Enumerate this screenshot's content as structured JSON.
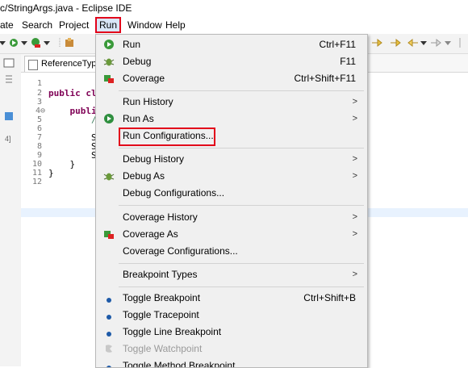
{
  "window": {
    "title": "c/StringArgs.java - Eclipse IDE"
  },
  "menubar": {
    "items": [
      "ate",
      "Search",
      "Project",
      "Run",
      "Window",
      "Help"
    ]
  },
  "editor": {
    "tab_label": "ReferenceType",
    "line_numbers": [
      "1",
      "2",
      "3",
      "4⊖",
      "5",
      "6",
      "7",
      "8",
      "9",
      "10",
      "11",
      "12"
    ],
    "code_lines": {
      "l2": "public cl",
      "l4": "    publi",
      "l5": "        /",
      "l7": "        S",
      "l8": "        S",
      "l9": "        S",
      "l10": "    }",
      "l11": "}"
    },
    "left_strip_marker": "4]"
  },
  "run_menu": {
    "items": [
      {
        "label": "Run",
        "accelerator": "Ctrl+F11",
        "icon": "run-green-icon"
      },
      {
        "label": "Debug",
        "accelerator": "F11",
        "icon": "debug-bug-icon"
      },
      {
        "label": "Coverage",
        "accelerator": "Ctrl+Shift+F11",
        "icon": "coverage-icon"
      },
      {
        "label": "Run History",
        "submenu": ">"
      },
      {
        "label": "Run As",
        "submenu": ">",
        "icon": "run-circle-icon"
      },
      {
        "label": "Run Configurations..."
      },
      {
        "label": "Debug History",
        "submenu": ">"
      },
      {
        "label": "Debug As",
        "submenu": ">",
        "icon": "debug-bug-icon"
      },
      {
        "label": "Debug Configurations..."
      },
      {
        "label": "Coverage History",
        "submenu": ">"
      },
      {
        "label": "Coverage As",
        "submenu": ">",
        "icon": "coverage-icon"
      },
      {
        "label": "Coverage Configurations..."
      },
      {
        "label": "Breakpoint Types",
        "submenu": ">"
      },
      {
        "label": "Toggle Breakpoint",
        "accelerator": "Ctrl+Shift+B",
        "icon": "breakpoint-dot-icon"
      },
      {
        "label": "Toggle Tracepoint",
        "icon": "breakpoint-dot-icon"
      },
      {
        "label": "Toggle Line Breakpoint",
        "icon": "breakpoint-dot-icon"
      },
      {
        "label": "Toggle Watchpoint",
        "icon": "watchpoint-icon",
        "disabled": true
      },
      {
        "label": "Toggle Method Breakpoint",
        "icon": "breakpoint-dot-icon"
      }
    ]
  },
  "colors": {
    "highlight_red": "#e2001a",
    "menu_bg": "#f0f0f0",
    "keyword": "#7f0055"
  }
}
